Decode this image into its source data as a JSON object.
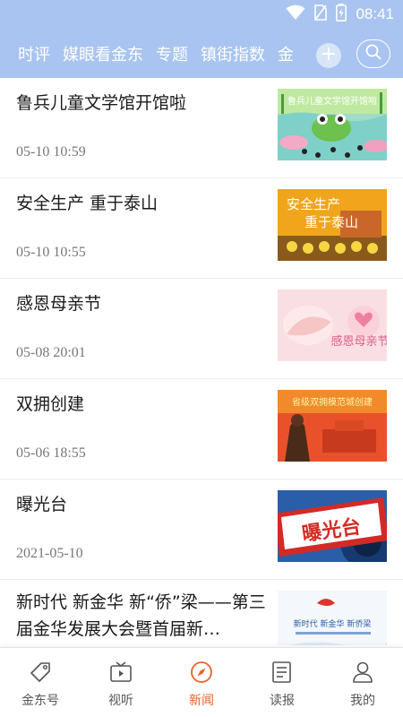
{
  "status": {
    "time": "08:41",
    "icons": [
      "wifi-icon",
      "sim-icon",
      "battery-charging-icon"
    ]
  },
  "tabs": [
    "时评",
    "媒眼看金东",
    "专题",
    "镇街指数",
    "金"
  ],
  "header": {
    "add_icon": "plus-icon",
    "search_icon": "search-icon"
  },
  "news": [
    {
      "title": "鲁兵儿童文学馆开馆啦",
      "time": "05-10  10:59",
      "thumb_text": "鲁兵儿童文学馆开馆啦"
    },
    {
      "title": "安全生产  重于泰山",
      "time": "05-10  10:55",
      "thumb_text": [
        "安全生产",
        "重于泰山"
      ]
    },
    {
      "title": "感恩母亲节",
      "time": "05-08  20:01",
      "thumb_text": "感恩母亲节"
    },
    {
      "title": "双拥创建",
      "time": "05-06  18:55",
      "thumb_text": "省级双拥模范城创建"
    },
    {
      "title": "曝光台",
      "time": "2021-05-10",
      "thumb_text": "曝光台"
    },
    {
      "title": "新时代 新金华 新“侨”梁——第三届金华发展大会暨首届新…",
      "thumb_text": "新时代 新金华 新侨梁"
    }
  ],
  "bottom_nav": [
    {
      "label": "金东号",
      "icon": "tag-icon"
    },
    {
      "label": "视听",
      "icon": "tv-play-icon"
    },
    {
      "label": "新闻",
      "icon": "compass-icon",
      "active": true
    },
    {
      "label": "读报",
      "icon": "newspaper-icon"
    },
    {
      "label": "我的",
      "icon": "person-icon"
    }
  ],
  "colors": {
    "header": "#a9c4f0",
    "active": "#e8632a"
  }
}
